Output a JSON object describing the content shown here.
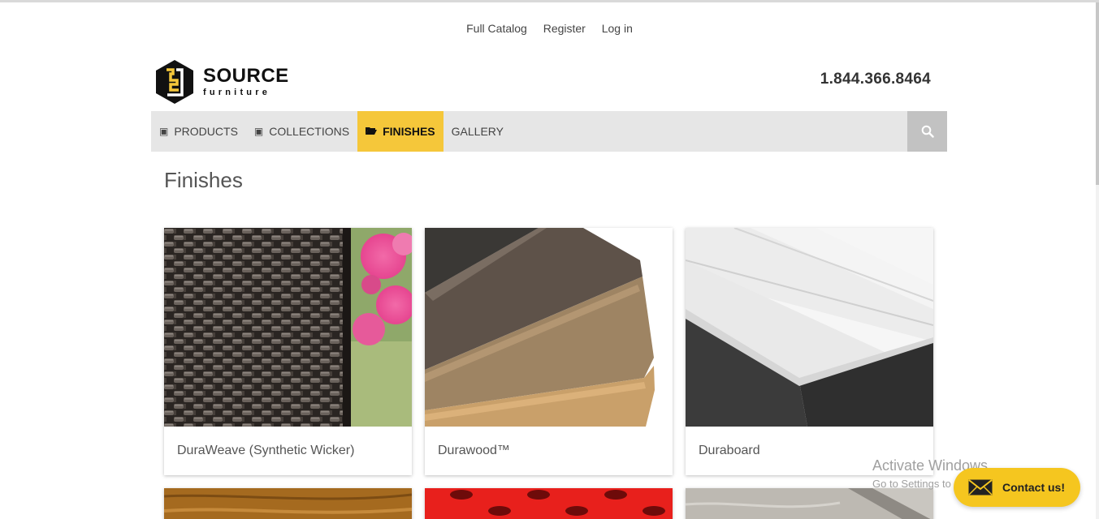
{
  "top_links": [
    "Full Catalog",
    "Register",
    "Log in"
  ],
  "logo": {
    "word": "SOURCE",
    "sub": "furniture"
  },
  "phone": "1.844.366.8464",
  "nav": [
    {
      "label": "PRODUCTS",
      "icon": "book-icon",
      "active": false
    },
    {
      "label": "COLLECTIONS",
      "icon": "book-icon",
      "active": false
    },
    {
      "label": "FINISHES",
      "icon": "folder-open-icon",
      "active": true
    },
    {
      "label": "GALLERY",
      "icon": "",
      "active": false
    }
  ],
  "search_icon": "search-icon",
  "page_title": "Finishes",
  "cards": [
    {
      "caption": "DuraWeave (Synthetic Wicker)"
    },
    {
      "caption": "Durawood™"
    },
    {
      "caption": "Duraboard"
    }
  ],
  "bottom_cards": [
    "wood-swatch",
    "red-perforated-swatch",
    "gray-stone-swatch"
  ],
  "watermark": {
    "title": "Activate Windows",
    "sub": "Go to Settings to activate Windows."
  },
  "contact": {
    "label": "Contact us!",
    "icon": "envelope-icon"
  },
  "colors": {
    "accent": "#f5c73a",
    "nav_bg": "#e6e6e6",
    "search_bg": "#c2c2c2"
  }
}
